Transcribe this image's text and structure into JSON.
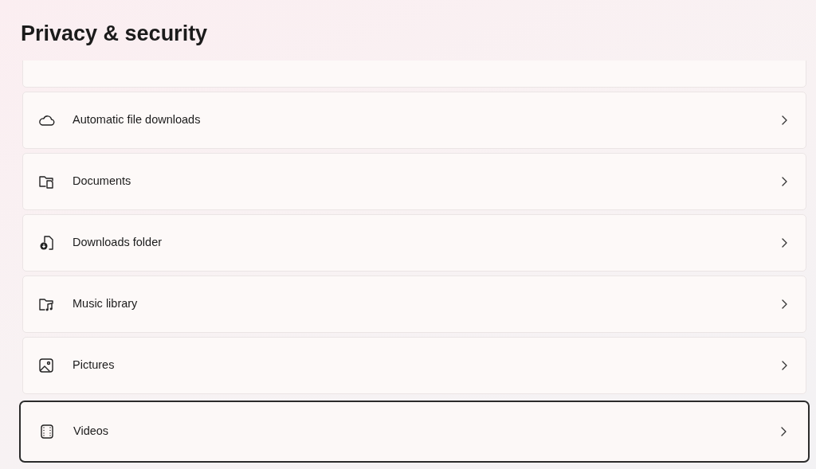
{
  "page": {
    "title": "Privacy & security"
  },
  "items": [
    {
      "label": "Automatic file downloads",
      "selected": false
    },
    {
      "label": "Documents",
      "selected": false
    },
    {
      "label": "Downloads folder",
      "selected": false
    },
    {
      "label": "Music library",
      "selected": false
    },
    {
      "label": "Pictures",
      "selected": false
    },
    {
      "label": "Videos",
      "selected": true
    }
  ]
}
